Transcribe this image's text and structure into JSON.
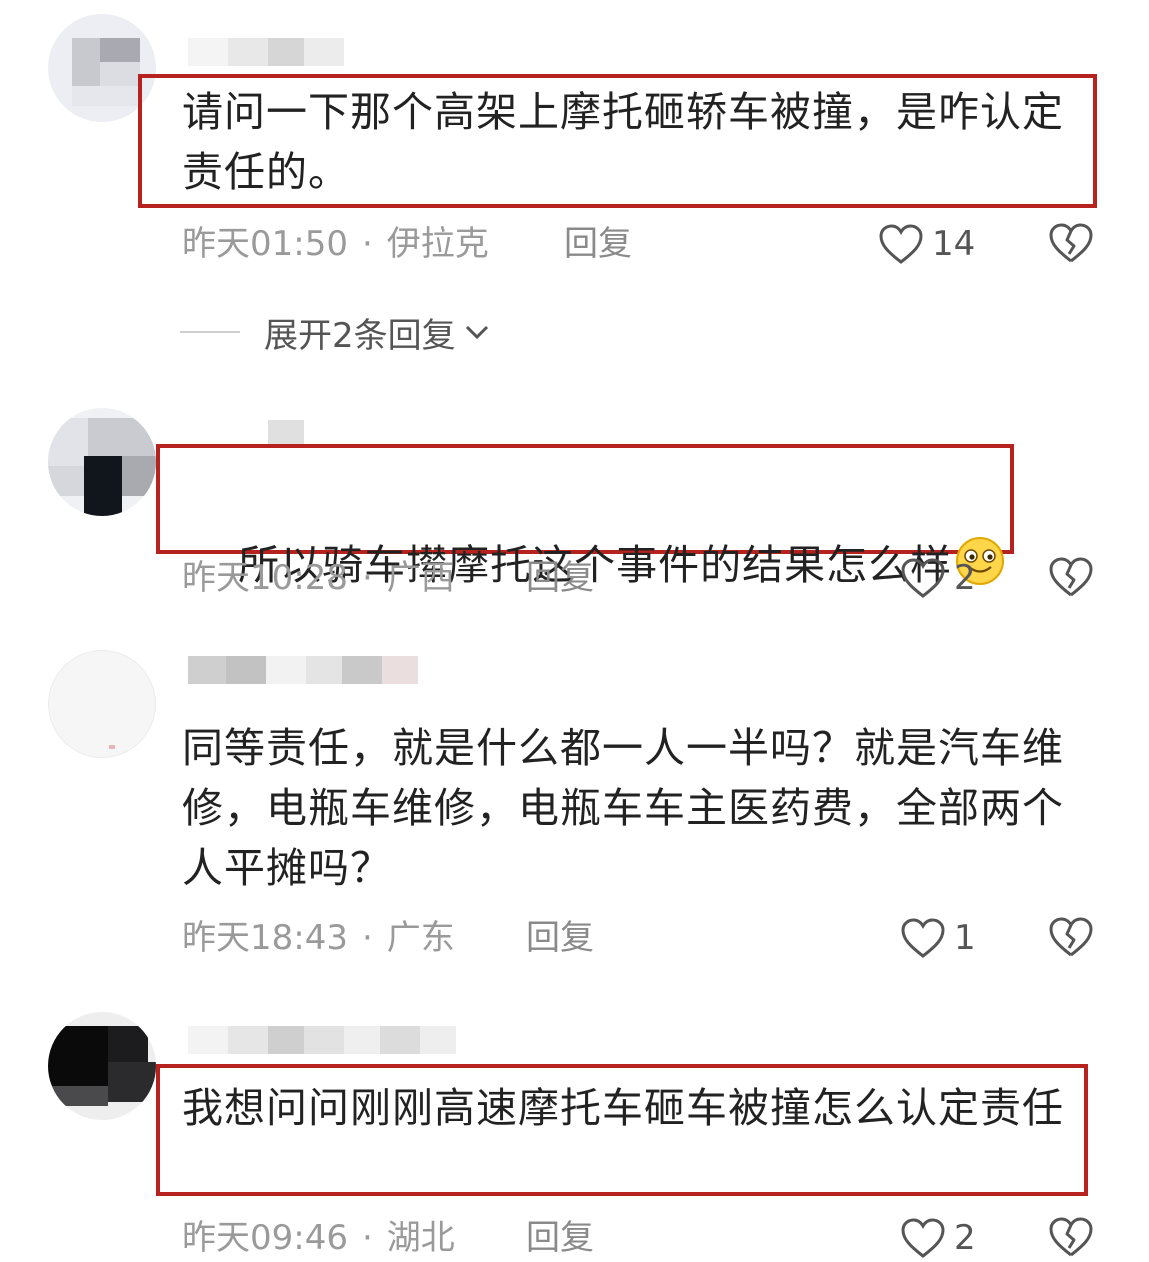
{
  "comments": [
    {
      "text": "请问一下那个高架上摩托砸轿车被撞，是咋认定责任的。",
      "time": "昨天01:50",
      "location": "伊拉克",
      "reply_label": "回复",
      "likes": "14",
      "highlighted": true
    },
    {
      "text": "所以骑车撵摩托这个事件的结果怎么样",
      "time": "昨天10:28",
      "location": "广西",
      "reply_label": "回复",
      "likes": "2",
      "highlighted": true,
      "emoji": "smile-emoji"
    },
    {
      "text": "同等责任，就是什么都一人一半吗？就是汽车维修，电瓶车维修，电瓶车车主医药费，全部两个人平摊吗？",
      "time": "昨天18:43",
      "location": "广东",
      "reply_label": "回复",
      "likes": "1",
      "highlighted": false
    },
    {
      "text": "我想问问刚刚高速摩托车砸车被撞怎么认定责任",
      "time": "昨天09:46",
      "location": "湖北",
      "reply_label": "回复",
      "likes": "2",
      "highlighted": true
    }
  ],
  "expand_replies": "展开2条回复",
  "colors": {
    "highlight_border": "#b6231f",
    "meta_text": "#9a9a9a",
    "body_text": "#222222"
  }
}
